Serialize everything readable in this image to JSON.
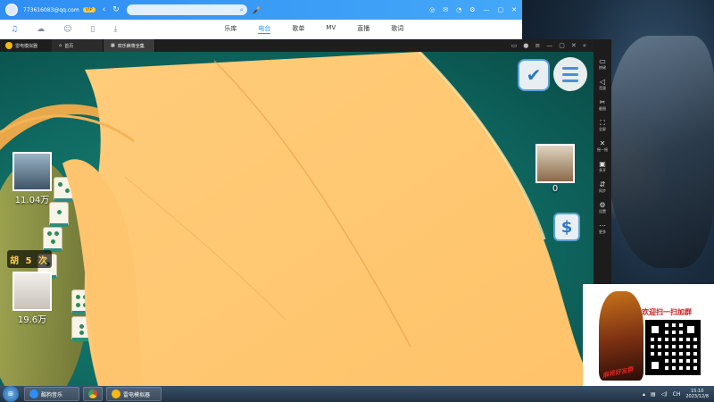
{
  "music_player": {
    "account": "773616083@qq.com",
    "vip_badge": "VIP",
    "search_placeholder": "",
    "tabs": [
      {
        "label": "乐库"
      },
      {
        "label": "电台",
        "active": true
      },
      {
        "label": "歌单"
      },
      {
        "label": "MV"
      },
      {
        "label": "直播"
      },
      {
        "label": "歌词"
      }
    ],
    "accent_color": "#2f8ef4"
  },
  "emulator": {
    "brand": "雷电模拟器",
    "tabs": [
      {
        "label": "首页"
      },
      {
        "label": "欢乐麻将全集",
        "active": true
      }
    ],
    "side_tools": [
      "按键",
      "音量",
      "截图",
      "全屏",
      "摇一摇",
      "多开",
      "同步",
      "设置",
      "更多"
    ]
  },
  "game": {
    "players": [
      {
        "score": "11.04万"
      },
      {
        "score": "19.6万"
      },
      {
        "score": "0"
      }
    ],
    "hu_badge": "胡 5 次",
    "ok_icon": "check-icon",
    "money_icon": "dollar-icon"
  },
  "qr_ad": {
    "headline": "欢迎扫一扫加群",
    "subline": "麻将好友群"
  },
  "taskbar": {
    "tasks": [
      {
        "label": "酷狗音乐"
      },
      {
        "label": "雷电模拟器"
      }
    ],
    "time": "15:10",
    "date": "2023/12/8",
    "lang": "CH"
  }
}
